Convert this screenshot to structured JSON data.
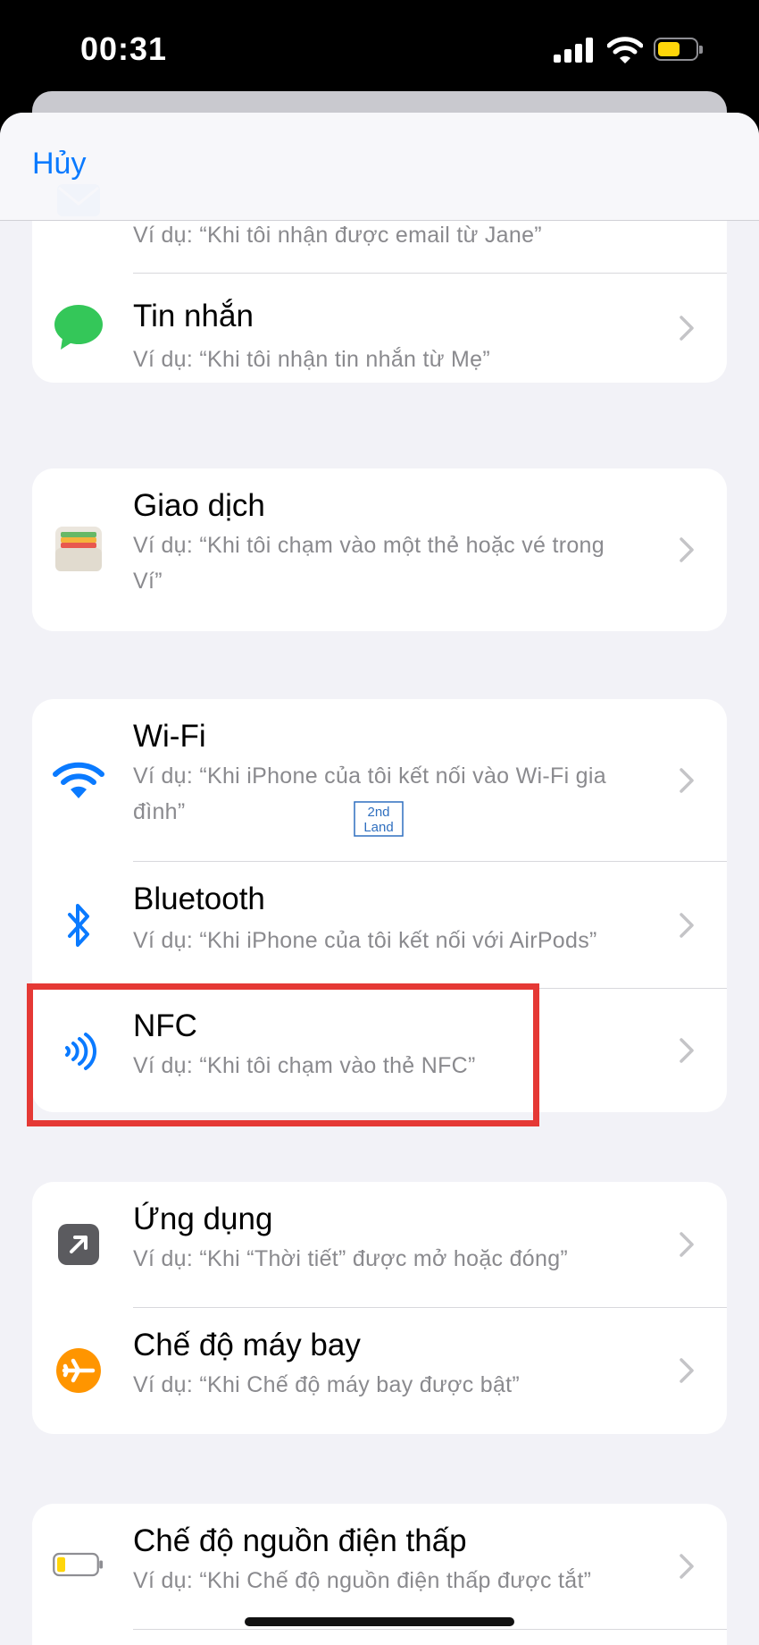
{
  "status_bar": {
    "time": "00:31"
  },
  "nav": {
    "cancel_label": "Hủy"
  },
  "groups": [
    {
      "rows": [
        {
          "title": "",
          "subtitle": "Ví dụ: “Khi tôi nhận được email từ Jane”",
          "icon": "mail-icon"
        },
        {
          "title": "Tin nhắn",
          "subtitle": "Ví dụ: “Khi tôi nhận tin nhắn từ Mẹ”",
          "icon": "messages-icon"
        }
      ]
    },
    {
      "rows": [
        {
          "title": "Giao dịch",
          "subtitle": "Ví dụ: “Khi tôi chạm vào một thẻ hoặc vé trong Ví”",
          "icon": "wallet-icon"
        }
      ]
    },
    {
      "rows": [
        {
          "title": "Wi-Fi",
          "subtitle": "Ví dụ: “Khi iPhone của tôi kết nối vào Wi-Fi gia đình”",
          "icon": "wifi-icon"
        },
        {
          "title": "Bluetooth",
          "subtitle": "Ví dụ: “Khi iPhone của tôi kết nối với AirPods”",
          "icon": "bluetooth-icon"
        },
        {
          "title": "NFC",
          "subtitle": "Ví dụ: “Khi tôi chạm vào thẻ NFC”",
          "icon": "nfc-icon"
        }
      ]
    },
    {
      "rows": [
        {
          "title": "Ứng dụng",
          "subtitle": "Ví dụ: “Khi “Thời tiết” được mở hoặc đóng”",
          "icon": "app-icon"
        },
        {
          "title": "Chế độ máy bay",
          "subtitle": "Ví dụ: “Khi Chế độ máy bay được bật”",
          "icon": "airplane-icon"
        }
      ]
    },
    {
      "rows": [
        {
          "title": "Chế độ nguồn điện thấp",
          "subtitle": "Ví dụ: “Khi Chế độ nguồn điện thấp được tắt”",
          "icon": "battery-icon"
        }
      ]
    }
  ],
  "watermark": {
    "line1": "2nd",
    "line2": "Land"
  },
  "colors": {
    "accent": "#0a7aff",
    "messages": "#34c759",
    "airplane": "#ff9500",
    "highlight": "#e53935"
  }
}
